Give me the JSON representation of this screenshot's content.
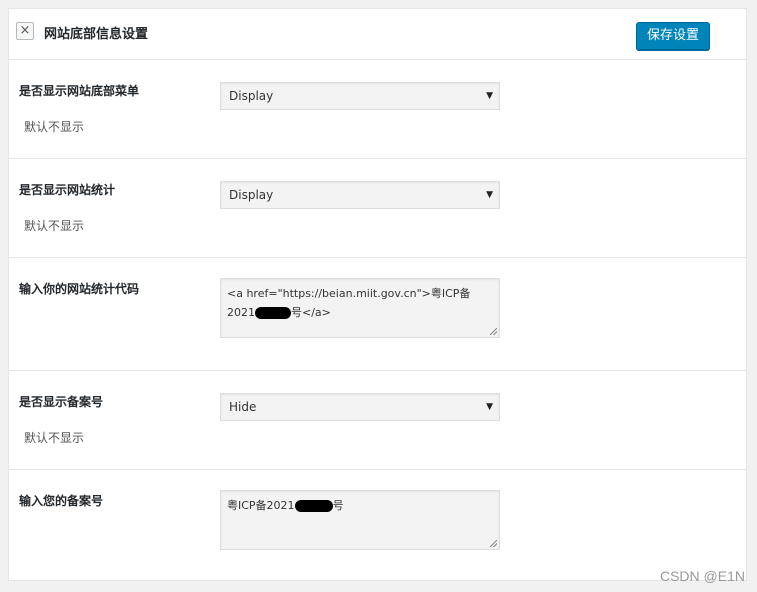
{
  "header": {
    "close_label": "×",
    "title": "网站底部信息设置",
    "save_label": "保存设置"
  },
  "rows": [
    {
      "label": "是否显示网站底部菜单",
      "value": "Display",
      "desc": "默认不显示"
    },
    {
      "label": "是否显示网站统计",
      "value": "Display",
      "desc": "默认不显示"
    },
    {
      "label": "输入你的网站统计代码",
      "value_line1": "<a href=\"https://beian.miit.gov.cn\">粤ICP备",
      "value_line2_prefix": "2021",
      "value_line2_suffix": "号</a>"
    },
    {
      "label": "是否显示备案号",
      "value": "Hide",
      "desc": "默认不显示"
    },
    {
      "label": "输入您的备案号",
      "value_prefix": "粤ICP备2021",
      "value_suffix": "号"
    }
  ],
  "icons": {
    "dropdown_arrow": "▼"
  },
  "watermark": "CSDN @E1N",
  "colors": {
    "primary_button": "#0085ba"
  }
}
